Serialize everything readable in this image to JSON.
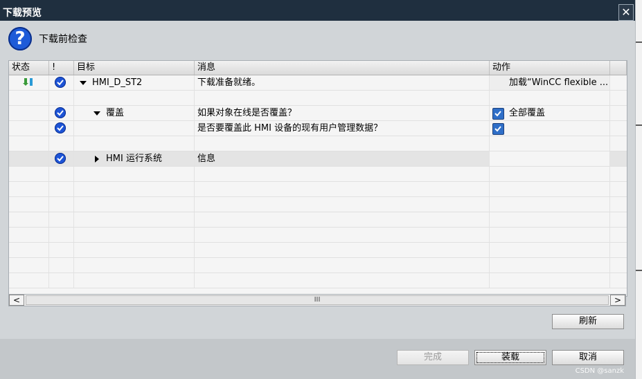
{
  "window": {
    "title": "下载预览",
    "close_glyph": "✕"
  },
  "header": {
    "label": "下载前检查",
    "icon": "question-icon"
  },
  "table": {
    "columns": [
      "状态",
      "!",
      "目标",
      "消息",
      "动作"
    ],
    "rows": [
      {
        "target": "HMI_D_ST2",
        "message": "下载准备就绪。",
        "action": "加载“WinCC flexible ..."
      },
      {
        "target": "覆盖",
        "message": "如果对象在线是否覆盖？",
        "action": "全部覆盖"
      },
      {
        "target": "",
        "message": "是否要覆盖此 HMI 设备的现有用户管理数据？",
        "action": ""
      },
      {
        "target": "HMI 运行系统",
        "message": "信息",
        "action": ""
      }
    ]
  },
  "scrollbar": {
    "thumb_glyph": "III",
    "left_glyph": "<",
    "right_glyph": ">"
  },
  "buttons": {
    "refresh": "刷新",
    "finish": "完成",
    "load": "装载",
    "cancel": "取消"
  },
  "watermark": "CSDN @sanzk",
  "colors": {
    "titlebar": "#1f2f3f",
    "check_blue": "#1d54d6",
    "dialog_bg": "#d1d5d8"
  }
}
